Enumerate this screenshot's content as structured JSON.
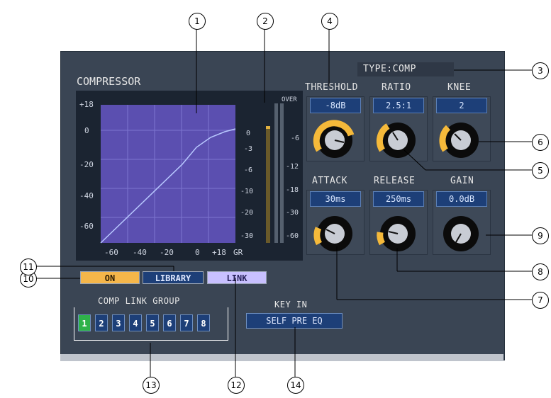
{
  "section_title": "COMPRESSOR",
  "type_display": "TYPE:COMP",
  "params_top": [
    {
      "label": "THRESHOLD",
      "value": "-8dB"
    },
    {
      "label": "RATIO",
      "value": "2.5:1"
    },
    {
      "label": "KNEE",
      "value": "2"
    }
  ],
  "params_bottom": [
    {
      "label": "ATTACK",
      "value": "30ms"
    },
    {
      "label": "RELEASE",
      "value": "250ms"
    },
    {
      "label": "GAIN",
      "value": "0.0dB"
    }
  ],
  "graph": {
    "x_ticks": [
      "-60",
      "-40",
      "-20",
      "0",
      "+18"
    ],
    "y_ticks": [
      "+18",
      "0",
      "-20",
      "-40",
      "-60"
    ]
  },
  "meter_gr": {
    "label": "GR",
    "ticks": [
      "0",
      "-3",
      "-6",
      "-10",
      "-20",
      "-30"
    ]
  },
  "meter_out": {
    "label": "OVER",
    "ticks": [
      "-6",
      "-12",
      "-18",
      "-30",
      "-60"
    ]
  },
  "buttons": {
    "on": "ON",
    "library": "LIBRARY",
    "link": "LINK"
  },
  "link_group": {
    "title": "COMP LINK GROUP",
    "items": [
      "1",
      "2",
      "3",
      "4",
      "5",
      "6",
      "7",
      "8"
    ],
    "selected": "1"
  },
  "key_in": {
    "title": "KEY IN",
    "value": "SELF PRE EQ"
  },
  "callouts": [
    "1",
    "2",
    "3",
    "4",
    "5",
    "6",
    "7",
    "8",
    "9",
    "10",
    "11",
    "12",
    "13",
    "14"
  ],
  "colors": {
    "accent_orange": "#f5b64a",
    "knob_ring": "#f5b93a",
    "graph_bg": "#5b4fb0",
    "link_green": "#2fb24a"
  }
}
